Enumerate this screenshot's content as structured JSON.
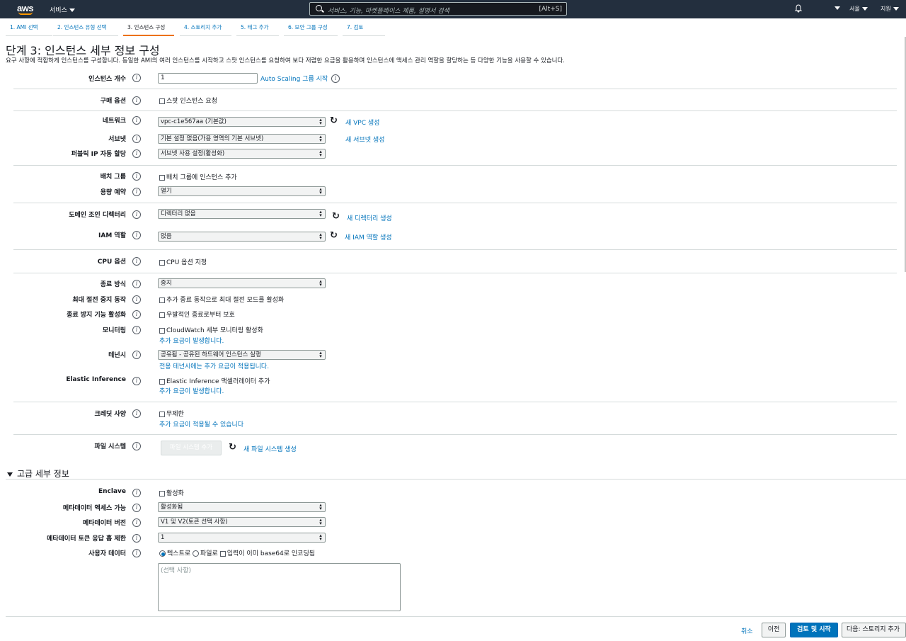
{
  "topnav": {
    "logo": "aws",
    "services": "서비스",
    "search_placeholder": "서비스, 기능, 마켓플레이스 제품, 설명서 검색",
    "search_shortcut": "[Alt+S]",
    "region": "서울",
    "support": "지원"
  },
  "steps": [
    "1. AMI 선택",
    "2. 인스턴스 유형 선택",
    "3. 인스턴스 구성",
    "4. 스토리지 추가",
    "5. 태그 추가",
    "6. 보안 그룹 구성",
    "7. 검토"
  ],
  "page": {
    "title": "단계 3: 인스턴스 세부 정보 구성",
    "description": "요구 사항에 적합하게 인스턴스를 구성합니다. 동일한 AMI의 여러 인스턴스를 시작하고 스팟 인스턴스를 요청하여 보다 저렴한 요금을 활용하며 인스턴스에 액세스 관리 역할을 할당하는 등 다양한 기능을 사용할 수 있습니다."
  },
  "form": {
    "instance_count": {
      "label": "인스턴스 개수",
      "value": "1",
      "link": "Auto Scaling 그룹 시작"
    },
    "purchase": {
      "label": "구매 옵션",
      "option": "스팟 인스턴스 요청"
    },
    "network": {
      "label": "네트워크",
      "value": "vpc-c1e567aa (기본값)",
      "link": "새 VPC 생성"
    },
    "subnet": {
      "label": "서브넷",
      "value": "기본 설정 없음(가용 영역의 기본 서브넷)",
      "link": "새 서브넷 생성"
    },
    "public_ip": {
      "label": "퍼블릭 IP 자동 할당",
      "value": "서브넷 사용 설정(활성화)"
    },
    "placement": {
      "label": "배치 그룹",
      "option": "배치 그룹에 인스턴스 추가"
    },
    "capacity": {
      "label": "용량 예약",
      "value": "열기"
    },
    "domain": {
      "label": "도메인 조인 디렉터리",
      "value": "디렉터리 없음",
      "link": "새 디렉터리 생성"
    },
    "iam": {
      "label": "IAM 역할",
      "value": "없음",
      "link": "새 IAM 역할 생성"
    },
    "cpu": {
      "label": "CPU 옵션",
      "option": "CPU 옵션 지정"
    },
    "shutdown": {
      "label": "종료 방식",
      "value": "중지"
    },
    "hibernate": {
      "label": "최대 절전 중지 동작",
      "option": "추가 종료 동작으로 최대 절전 모드를 활성화"
    },
    "termination": {
      "label": "종료 방지 기능 활성화",
      "option": "우발적인 종료로부터 보호"
    },
    "monitoring": {
      "label": "모니터링",
      "option": "CloudWatch 세부 모니터링 활성화",
      "note": "추가 요금이 발생합니다."
    },
    "tenancy": {
      "label": "테넌시",
      "value": "공유됨 - 공유된 하드웨어 인스턴스 실행",
      "note": "전용 테넌시에는 추가 요금이 적용됩니다."
    },
    "elastic": {
      "label": "Elastic Inference",
      "option": "Elastic Inference 액셀러레이터 추가",
      "note": "추가 요금이 발생합니다."
    },
    "credit": {
      "label": "크레딧 사양",
      "option": "무제한",
      "note": "추가 요금이 적용될 수 있습니다"
    },
    "filesystem": {
      "label": "파일 시스템",
      "button": "파일 시스템 추가",
      "link": "새 파일 시스템 생성"
    }
  },
  "advanced": {
    "title": "고급 세부 정보",
    "enclave": {
      "label": "Enclave",
      "option": "활성화"
    },
    "metadata_access": {
      "label": "메타데이터 액세스 가능",
      "value": "활성화됨"
    },
    "metadata_version": {
      "label": "메타데이터 버전",
      "value": "V1 및 V2(토큰 선택 사항)"
    },
    "hop_limit": {
      "label": "메타데이터 토큰 응답 홉 제한",
      "value": "1"
    },
    "user_data": {
      "label": "사용자 데이터",
      "radio_text": "텍스트로",
      "radio_file": "파일로",
      "base64": "입력이 이미 base64로 인코딩됨",
      "placeholder": "(선택 사항)"
    }
  },
  "footer": {
    "cancel": "취소",
    "previous": "이전",
    "review": "검토 및 시작",
    "next": "다음: 스토리지 추가"
  }
}
